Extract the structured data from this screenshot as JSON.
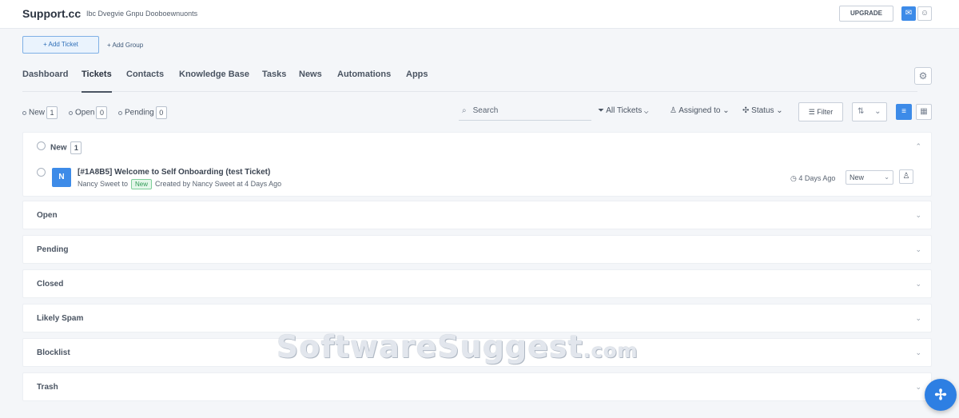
{
  "topbar": {
    "brand": "Support.cc",
    "tagline": "Ibc Dvegvie Gnpu Dooboewnuonts",
    "upgrade_label": "UPGRADE",
    "mail_icon": "mail-icon",
    "user_icon": "user-icon"
  },
  "actions": {
    "add_ticket_label": "+ Add Ticket",
    "add_group_label": "+ Add Group"
  },
  "tabs": [
    {
      "label": "Dashboard"
    },
    {
      "label": "Tickets"
    },
    {
      "label": "Contacts"
    },
    {
      "label": "Knowledge Base"
    },
    {
      "label": "Tasks"
    },
    {
      "label": "News"
    },
    {
      "label": "Automations"
    },
    {
      "label": "Apps"
    }
  ],
  "filters": {
    "new_label": "New",
    "new_count": "1",
    "open_label": "Open",
    "open_count": "0",
    "pending_label": "Pending",
    "pending_count": "0",
    "search_placeholder": "Search",
    "all_tickets_label": "All Tickets",
    "assigned_label": "Assigned to",
    "status_label": "Status",
    "filter_label": "Filter"
  },
  "groups": {
    "new": {
      "title": "New",
      "count": "1"
    },
    "open": {
      "title": "Open"
    },
    "pending": {
      "title": "Pending"
    },
    "closed": {
      "title": "Closed"
    },
    "likely_spam": {
      "title": "Likely Spam"
    },
    "blocklist": {
      "title": "Blocklist"
    },
    "trash": {
      "title": "Trash"
    }
  },
  "ticket": {
    "avatar_initials": "N",
    "subject": "[#1A8B5] Welcome to Self Onboarding (test Ticket)",
    "from": "Nancy Sweet to",
    "status_badge": "New",
    "meta": "Created by Nancy Sweet at 4 Days Ago",
    "time": "4 Days Ago",
    "status_value": "New"
  },
  "watermark": {
    "main": "SoftwareSuggest",
    "suffix": ".com"
  },
  "colors": {
    "accent": "#3d8be8",
    "fab": "#2d7fe3",
    "new_badge": "#2e9a55"
  }
}
